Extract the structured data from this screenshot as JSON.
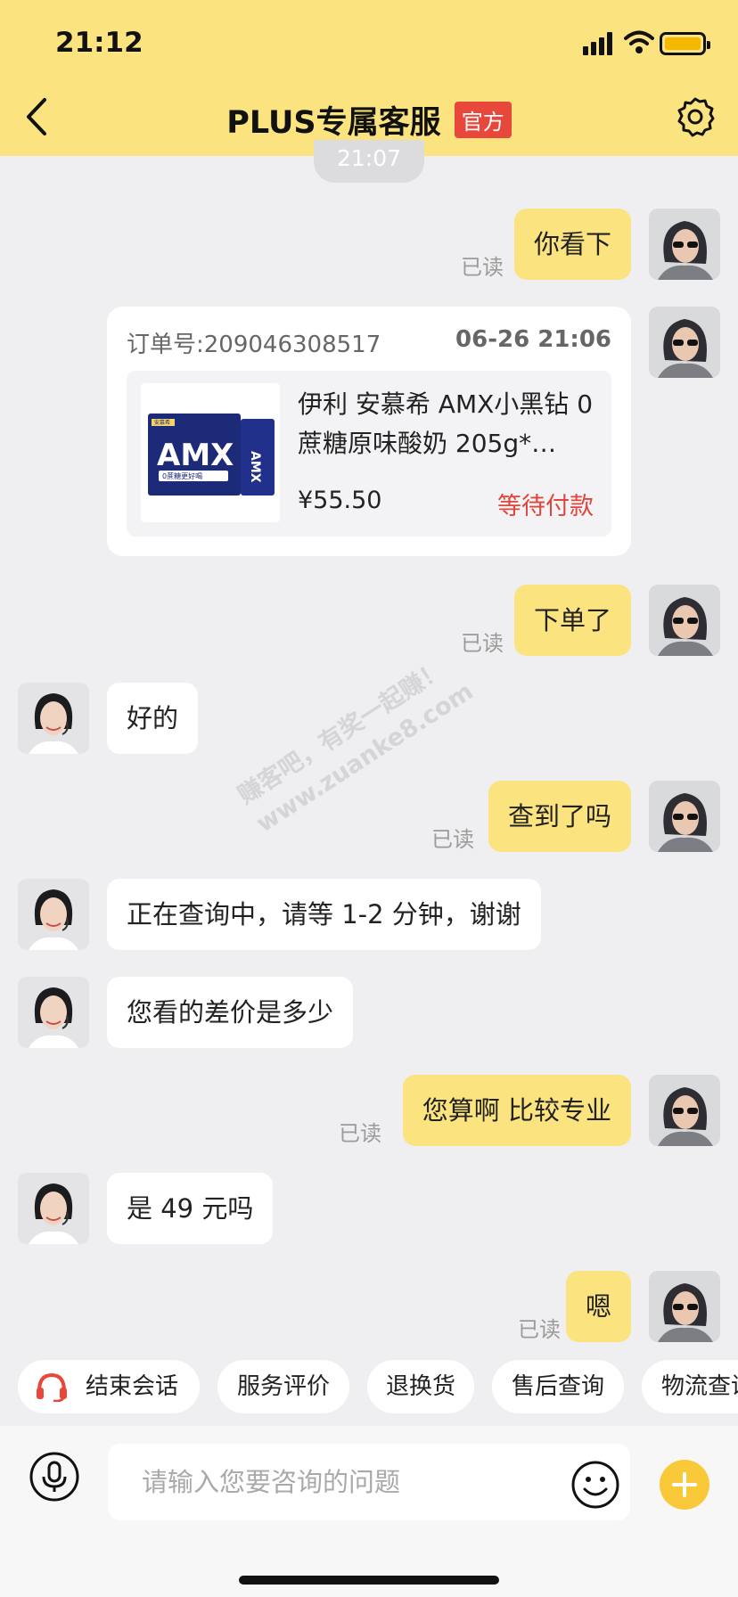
{
  "status_bar": {
    "time": "21:12"
  },
  "header": {
    "title": "PLUS专属客服",
    "badge": "官方"
  },
  "chat": {
    "timestamp": "21:07",
    "read_label": "已读",
    "messages": [
      {
        "from": "user",
        "text": "你看下"
      },
      {
        "from": "user",
        "type": "order_card"
      },
      {
        "from": "user",
        "text": "下单了"
      },
      {
        "from": "agent",
        "text": "好的"
      },
      {
        "from": "user",
        "text": "查到了吗"
      },
      {
        "from": "agent",
        "text": "正在查询中，请等 1-2 分钟，谢谢"
      },
      {
        "from": "agent",
        "text": "您看的差价是多少"
      },
      {
        "from": "user",
        "text": "您算啊 比较专业"
      },
      {
        "from": "agent",
        "text": "是 49 元吗"
      },
      {
        "from": "user",
        "text": "嗯"
      }
    ],
    "order_card": {
      "order_number": "订单号:209046308517",
      "time": "06-26 21:06",
      "product_name": "伊利 安慕希 AMX小黑钻 0蔗糖原味酸奶 205g*…",
      "price": "¥55.50",
      "status": "等待付款",
      "image_brand": "AMX",
      "image_brand_small": "安慕希",
      "image_tagline": "0蔗糖更好喝"
    }
  },
  "watermark": {
    "line1": "赚客吧，有奖一起赚！",
    "line2": "www.zuanke8.com"
  },
  "quick_actions": [
    "结束会话",
    "服务评价",
    "退换货",
    "售后查询",
    "物流查询"
  ],
  "input": {
    "placeholder": "请输入您要咨询的问题"
  },
  "colors": {
    "header_bg": "#fbe37f",
    "user_bubble": "#fbe37f",
    "badge": "#e8473b",
    "status_red": "#e0463b",
    "plus_button": "#f9c93a"
  }
}
